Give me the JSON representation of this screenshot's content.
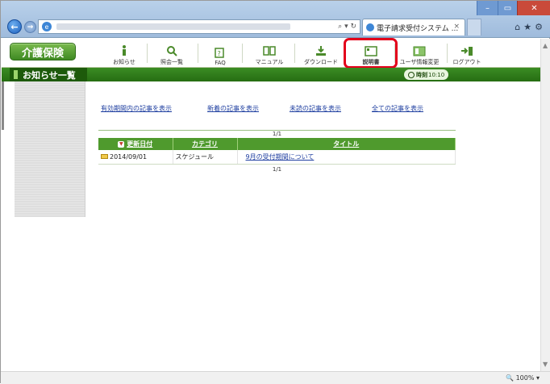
{
  "browser": {
    "tab_title": "電子請求受付システム ...",
    "tab_close": "×",
    "address_tools": "⌕ ▾ ↻",
    "back_glyph": "←",
    "forward_glyph": "→",
    "ie_glyph": "e",
    "min_glyph": "–",
    "max_glyph": "▭",
    "close_glyph": "✕",
    "right_tools": "⌂★⚙",
    "zoom": "100%"
  },
  "app": {
    "brand": "介護保険",
    "menu": [
      {
        "label": "お知らせ",
        "icon": "info-icon"
      },
      {
        "label": "照会一覧",
        "icon": "search-icon"
      },
      {
        "label": "FAQ",
        "icon": "faq-icon"
      },
      {
        "label": "マニュアル",
        "icon": "book-icon"
      },
      {
        "label": "ダウンロード",
        "icon": "download-icon"
      },
      {
        "label": "説明書",
        "icon": "document-icon"
      },
      {
        "label": "ユーザ情報変更",
        "icon": "user-card-icon"
      },
      {
        "label": "ログアウト",
        "icon": "logout-icon"
      }
    ],
    "section_title": "お知らせ一覧",
    "clock_label": "時刻",
    "clock_value": "10:10"
  },
  "filters": [
    "有効期間内の記事を表示",
    "新着の記事を表示",
    "未読の記事を表示",
    "全ての記事を表示"
  ],
  "table": {
    "pager_top": "1/1",
    "pager_bottom": "1/1",
    "sort_glyph": "▼",
    "columns": [
      "更新日付",
      "カテゴリ",
      "タイトル"
    ],
    "rows": [
      {
        "date": "2014/09/01",
        "category": "スケジュール",
        "title": "9月の受付期間について"
      }
    ]
  },
  "colors": {
    "brand_green": "#3f8a23",
    "header_green": "#4f9a2d",
    "highlight_red": "#e3001b"
  }
}
